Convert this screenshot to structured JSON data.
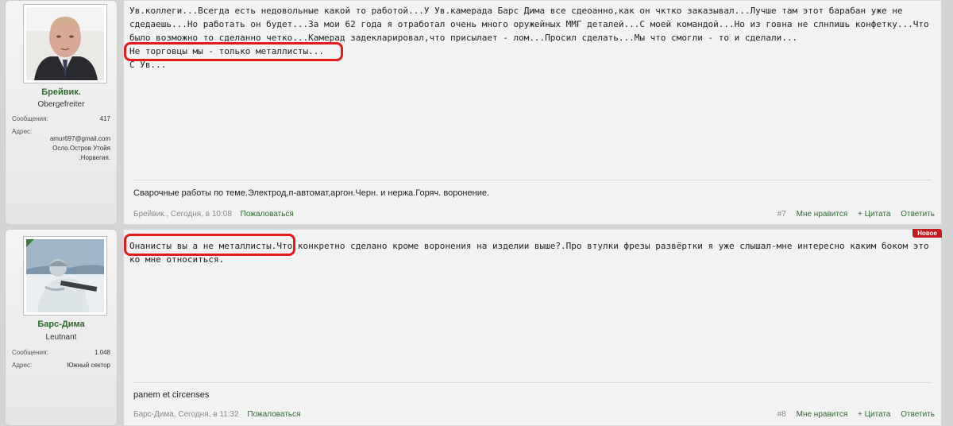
{
  "posts": [
    {
      "user": {
        "name": "Брейвик.",
        "rank": "Obergefreiter",
        "messages_label": "Сообщения:",
        "messages_count": "417",
        "address_label": "Адрес:",
        "address_lines": [
          "amur697@gmail.com",
          "Осло.Остров Утойя",
          ".Норвегия."
        ]
      },
      "text": "Ув.коллеги...Всегда есть недовольные какой то работой...У Ув.камерада Барс Дима все сдеоанно,как он чктко заказывал...Лучше там этот барабан уже не сдедаешь...Но работать он будет...За мои 62 года я отработал очень много оружейных ММГ деталей...С моей командой...Но из говна не слнпишь конфетку...Что было возможно то сделанно четко...Камерад задекларировал,что присылает - лом...Просил сделать...Мы что смогли - то и сделали...\nНе торговцы мы - только металлисты...\nС Ув...",
      "signature": "Сварочные работы по теме.Электрод,п-автомат,аргон.Черн. и нержа.Горяч. воронение.",
      "meta": "Брейвик., Сегодня, в 10:08",
      "report": "Пожаловаться",
      "number": "#7",
      "like": "Мне нравится",
      "quote": "+ Цитата",
      "reply": "Ответить"
    },
    {
      "user": {
        "name": "Барс-Дима",
        "rank": "Leutnant",
        "messages_label": "Сообщения:",
        "messages_count": "1.048",
        "address_label": "Адрес:",
        "address_value": "Южный сектор"
      },
      "badge": "Новое",
      "text": "Онанисты вы а не металлисты.Что конкретно сделано кроме воронения на изделии выше?.Про втулки фрезы развёртки я уже слышал-мне интересно каким боком это ко мне относиться.",
      "signature": "panem et circenses",
      "meta": "Барс-Дима, Сегодня, в 11:32",
      "report": "Пожаловаться",
      "number": "#8",
      "like": "Мне нравится",
      "quote": "+ Цитата",
      "reply": "Ответить"
    }
  ]
}
